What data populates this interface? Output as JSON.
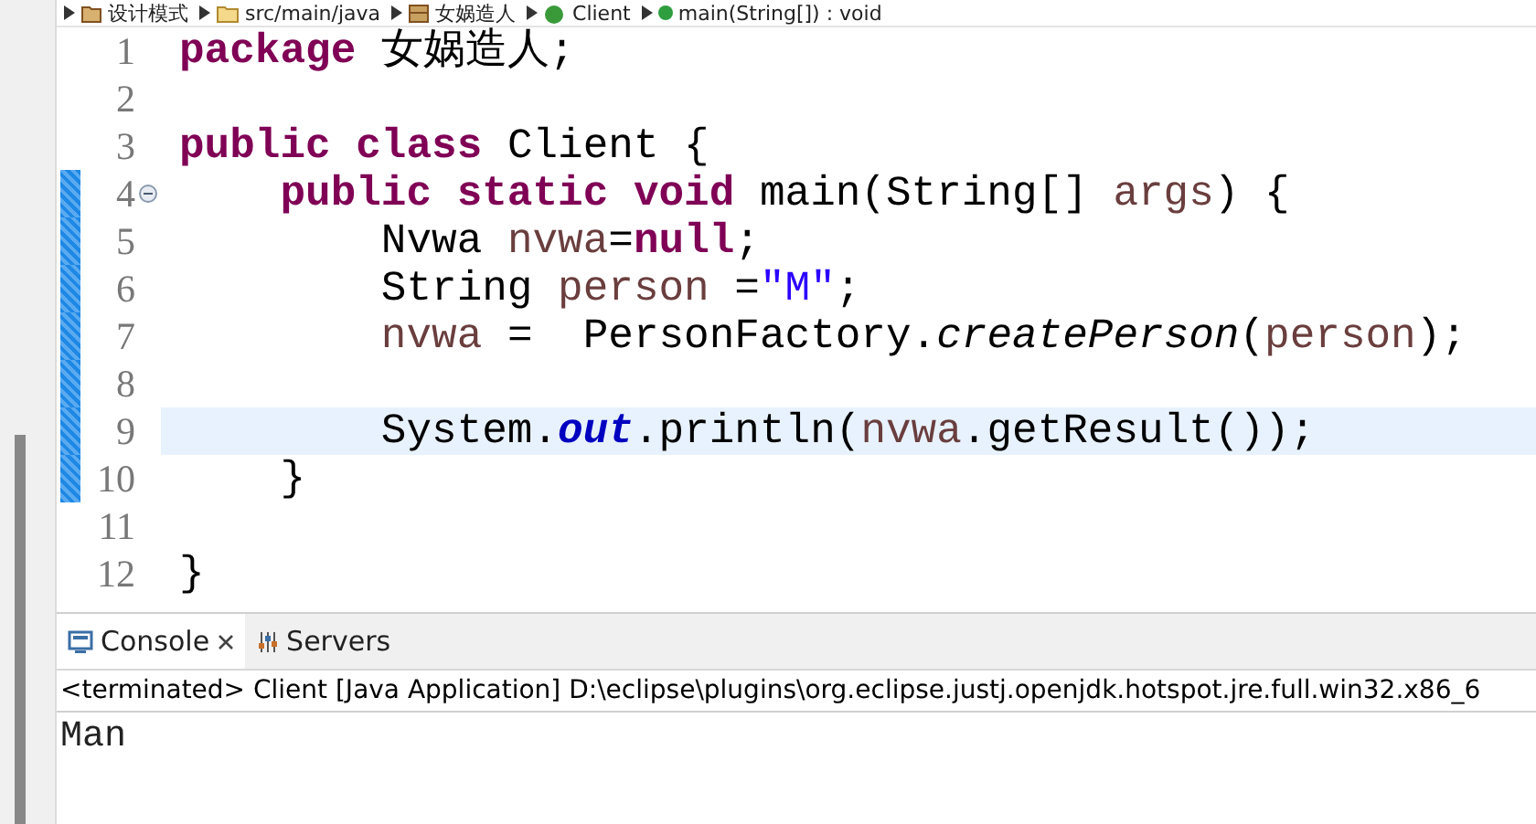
{
  "breadcrumb": [
    {
      "label": "设计模式",
      "kind": "project"
    },
    {
      "label": "src/main/java",
      "kind": "folder"
    },
    {
      "label": "女娲造人",
      "kind": "package"
    },
    {
      "label": "Client",
      "kind": "class"
    },
    {
      "label": "main(String[]) : void",
      "kind": "method"
    }
  ],
  "editor": {
    "lines": [
      {
        "number": "1",
        "changed": false,
        "foldable": false,
        "current": false,
        "tokens": [
          {
            "kind": "keyword",
            "text": "package"
          },
          {
            "kind": "plain",
            "text": " 女娲造人;"
          }
        ]
      },
      {
        "number": "2",
        "changed": false,
        "foldable": false,
        "current": false
      },
      {
        "number": "3",
        "changed": false,
        "foldable": false,
        "current": false,
        "tokens": [
          {
            "kind": "keyword",
            "text": "public class"
          },
          {
            "kind": "plain",
            "text": " Client {"
          }
        ]
      },
      {
        "number": "4",
        "changed": true,
        "foldable": true,
        "current": false,
        "tokens": [
          {
            "kind": "keyword",
            "text": "    public static void"
          },
          {
            "kind": "plain",
            "text": " main(String[] "
          },
          {
            "kind": "variable",
            "text": "args"
          },
          {
            "kind": "plain",
            "text": ") {"
          }
        ]
      },
      {
        "number": "5",
        "changed": true,
        "foldable": false,
        "current": false,
        "tokens": [
          {
            "kind": "plain",
            "text": "        Nvwa "
          },
          {
            "kind": "variable",
            "text": "nvwa"
          },
          {
            "kind": "plain",
            "text": "="
          },
          {
            "kind": "keyword",
            "text": "null"
          },
          {
            "kind": "plain",
            "text": ";"
          }
        ]
      },
      {
        "number": "6",
        "changed": true,
        "foldable": false,
        "current": false,
        "tokens": [
          {
            "kind": "plain",
            "text": "        String "
          },
          {
            "kind": "variable",
            "text": "person"
          },
          {
            "kind": "plain",
            "text": " ="
          },
          {
            "kind": "string",
            "text": "\"M\""
          },
          {
            "kind": "plain",
            "text": ";"
          }
        ]
      },
      {
        "number": "7",
        "changed": true,
        "foldable": false,
        "current": false,
        "tokens": [
          {
            "kind": "variable",
            "text": "        nvwa"
          },
          {
            "kind": "plain",
            "text": " =  PersonFactory."
          },
          {
            "kind": "static-method",
            "text": "createPerson"
          },
          {
            "kind": "plain",
            "text": "("
          },
          {
            "kind": "variable",
            "text": "person"
          },
          {
            "kind": "plain",
            "text": ");"
          }
        ]
      },
      {
        "number": "8",
        "changed": true,
        "foldable": false,
        "current": false
      },
      {
        "number": "9",
        "changed": true,
        "foldable": false,
        "current": true,
        "tokens": [
          {
            "kind": "plain",
            "text": "        System."
          },
          {
            "kind": "static-field",
            "text": "out"
          },
          {
            "kind": "plain",
            "text": ".println("
          },
          {
            "kind": "variable",
            "text": "nvwa"
          },
          {
            "kind": "plain",
            "text": ".getResult());"
          }
        ]
      },
      {
        "number": "10",
        "changed": true,
        "foldable": false,
        "current": false,
        "tokens": [
          {
            "kind": "plain",
            "text": "    }"
          }
        ]
      },
      {
        "number": "11",
        "changed": false,
        "foldable": false,
        "current": false
      },
      {
        "number": "12",
        "changed": false,
        "foldable": false,
        "current": false,
        "tokens": [
          {
            "kind": "plain",
            "text": "}"
          }
        ]
      }
    ]
  },
  "console": {
    "tabs": [
      {
        "label": "Console",
        "kind": "console",
        "selected": true,
        "closable": true
      },
      {
        "label": "Servers",
        "kind": "servers",
        "selected": false,
        "closable": false
      }
    ],
    "status": "<terminated> Client [Java Application] D:\\eclipse\\plugins\\org.eclipse.justj.openjdk.hotspot.jre.full.win32.x86_6",
    "output": "Man"
  }
}
